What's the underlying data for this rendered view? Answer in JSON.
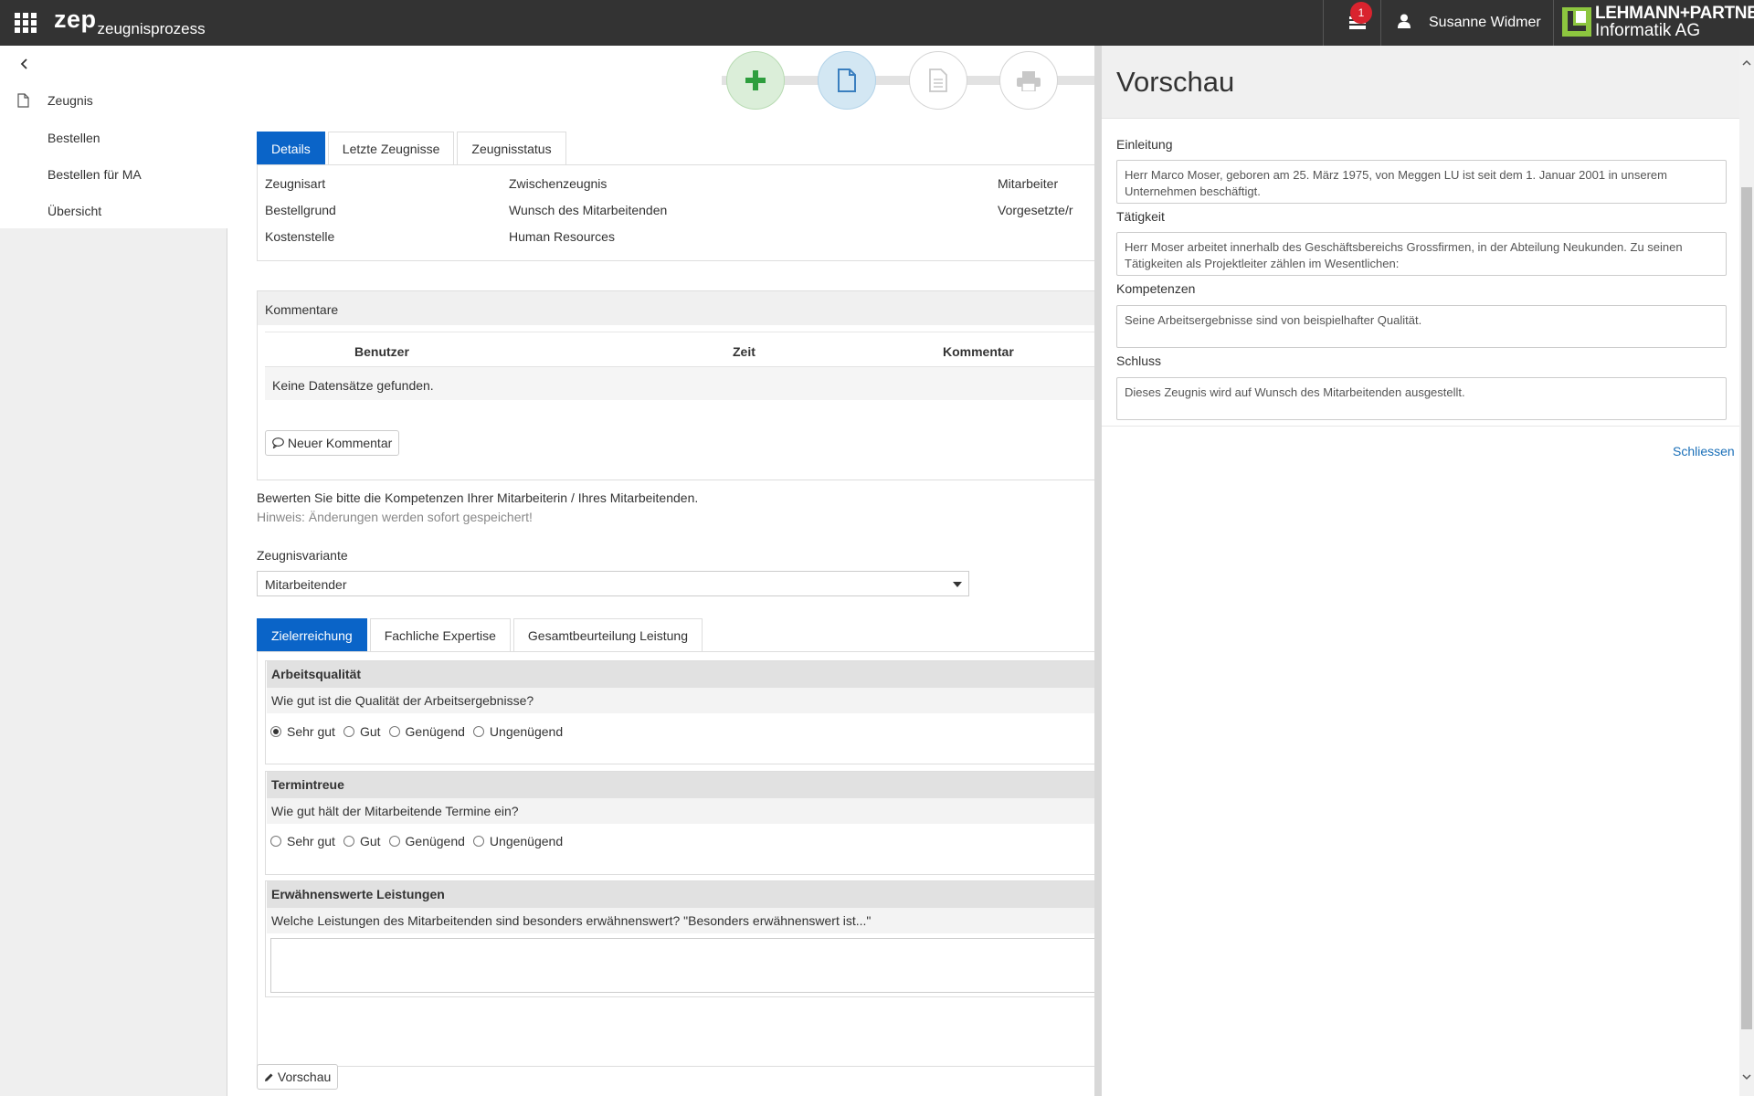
{
  "header": {
    "brand_main": "zep",
    "brand_sub": "zeugnisprozess",
    "notification_count": "1",
    "user_name": "Susanne Widmer",
    "logo_line1": "LEHMANN+PARTNER",
    "logo_line2": "Informatik AG",
    "logo_color": "#8dc63f"
  },
  "sidebar": {
    "section": "Zeugnis",
    "items": [
      "Bestellen",
      "Bestellen für MA",
      "Übersicht"
    ]
  },
  "workflow": {
    "steps": [
      {
        "icon": "plus-icon",
        "state": "done",
        "color": "#2e9e3e"
      },
      {
        "icon": "document-icon",
        "state": "active",
        "color": "#3a7fbf"
      },
      {
        "icon": "document-lines-icon",
        "state": "pending",
        "color": "#c8c8c8"
      },
      {
        "icon": "print-icon",
        "state": "pending",
        "color": "#c8c8c8"
      }
    ]
  },
  "details_tabs": [
    "Details",
    "Letzte Zeugnisse",
    "Zeugnisstatus"
  ],
  "details": {
    "rows": [
      {
        "label": "Zeugnisart",
        "value": "Zwischenzeugnis",
        "right_label": "Mitarbeiter"
      },
      {
        "label": "Bestellgrund",
        "value": "Wunsch des Mitarbeitenden",
        "right_label": "Vorgesetzte/r"
      },
      {
        "label": "Kostenstelle",
        "value": "Human Resources",
        "right_label": ""
      }
    ]
  },
  "comments": {
    "title": "Kommentare",
    "columns": [
      "Benutzer",
      "Zeit",
      "Kommentar"
    ],
    "empty": "Keine Datensätze gefunden.",
    "new_button": "Neuer Kommentar"
  },
  "rating": {
    "instruction": "Bewerten Sie bitte die Kompetenzen Ihrer Mitarbeiterin / Ihres Mitarbeitenden.",
    "hint": "Hinweis: Änderungen werden sofort gespeichert!",
    "variant_label": "Zeugnisvariante",
    "variant_value": "Mitarbeitender"
  },
  "rating_tabs": [
    "Zielerreichung",
    "Fachliche Expertise",
    "Gesamtbeurteilung Leistung"
  ],
  "options": [
    "Sehr gut",
    "Gut",
    "Genügend",
    "Ungenügend"
  ],
  "questions": [
    {
      "title": "Arbeitsqualität",
      "question": "Wie gut ist die Qualität der Arbeitsergebnisse?",
      "selected": "Sehr gut"
    },
    {
      "title": "Termintreue",
      "question": "Wie gut hält der Mitarbeitende Termine ein?",
      "selected": ""
    }
  ],
  "notable": {
    "title": "Erwähnenswerte Leistungen",
    "question": "Welche Leistungen des Mitarbeitenden sind besonders erwähnenswert? \"Besonders erwähnenswert ist...\"",
    "value": ""
  },
  "preview_button": "Vorschau",
  "preview": {
    "title": "Vorschau",
    "sections": [
      {
        "label": "Einleitung",
        "text": "Herr Marco Moser, geboren am 25. März 1975, von Meggen LU ist seit dem 1. Januar 2001 in unserem Unternehmen beschäftigt."
      },
      {
        "label": "Tätigkeit",
        "text": "Herr Moser arbeitet innerhalb des Geschäftsbereichs Grossfirmen, in der Abteilung Neukunden. Zu seinen Tätigkeiten als Projektleiter zählen im Wesentlichen:"
      },
      {
        "label": "Kompetenzen",
        "text": "Seine Arbeitsergebnisse sind von beispielhafter Qualität."
      },
      {
        "label": "Schluss",
        "text": "Dieses Zeugnis wird auf Wunsch des Mitarbeitenden ausgestellt."
      }
    ],
    "close_label": "Schliessen"
  }
}
